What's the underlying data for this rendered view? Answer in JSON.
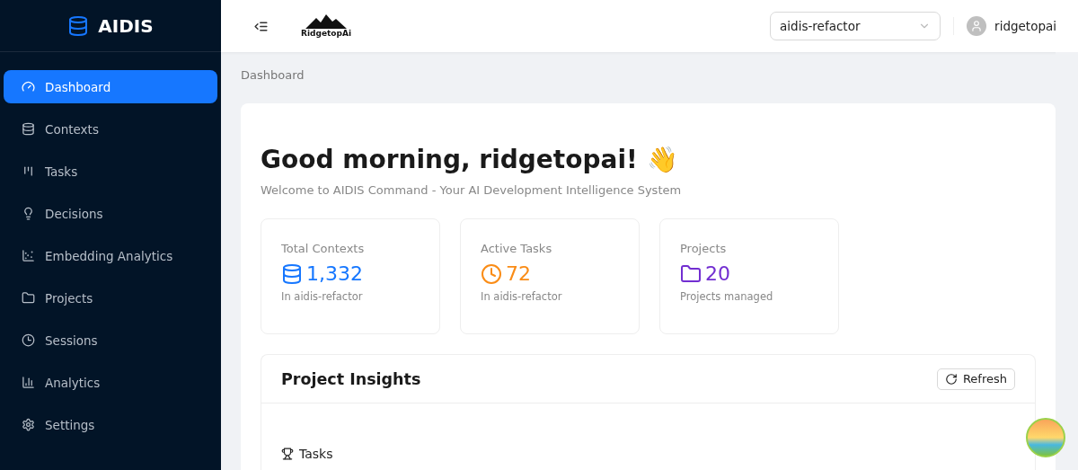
{
  "sidebar": {
    "brand": "AIDIS",
    "items": [
      {
        "label": "Dashboard",
        "kind": "dashboard",
        "selected": true
      },
      {
        "label": "Contexts",
        "kind": "contexts",
        "selected": false
      },
      {
        "label": "Tasks",
        "kind": "tasks",
        "selected": false
      },
      {
        "label": "Decisions",
        "kind": "decisions",
        "selected": false
      },
      {
        "label": "Embedding Analytics",
        "kind": "embedding",
        "selected": false
      },
      {
        "label": "Projects",
        "kind": "projects",
        "selected": false
      },
      {
        "label": "Sessions",
        "kind": "sessions",
        "selected": false
      },
      {
        "label": "Analytics",
        "kind": "analytics",
        "selected": false
      },
      {
        "label": "Settings",
        "kind": "settings",
        "selected": false
      }
    ]
  },
  "header": {
    "logo_text": "RidgetopAi",
    "project_select": {
      "value": "aidis-refactor"
    },
    "user": "ridgetopai"
  },
  "breadcrumb": "Dashboard",
  "greeting": {
    "title": "Good morning, ridgetopai! 👋",
    "subtitle": "Welcome to AIDIS Command - Your AI Development Intelligence System"
  },
  "stats": [
    {
      "label": "Total Contexts",
      "value": "1,332",
      "note": "In aidis-refactor",
      "kind": "database",
      "color": "#1677ff"
    },
    {
      "label": "Active Tasks",
      "value": "72",
      "note": "In aidis-refactor",
      "kind": "clock",
      "color": "#fa8c16"
    },
    {
      "label": "Projects",
      "value": "20",
      "note": "Projects managed",
      "kind": "folder",
      "color": "#722ed1"
    }
  ],
  "insights": {
    "title": "Project Insights",
    "refresh": "Refresh",
    "section": "Tasks"
  }
}
